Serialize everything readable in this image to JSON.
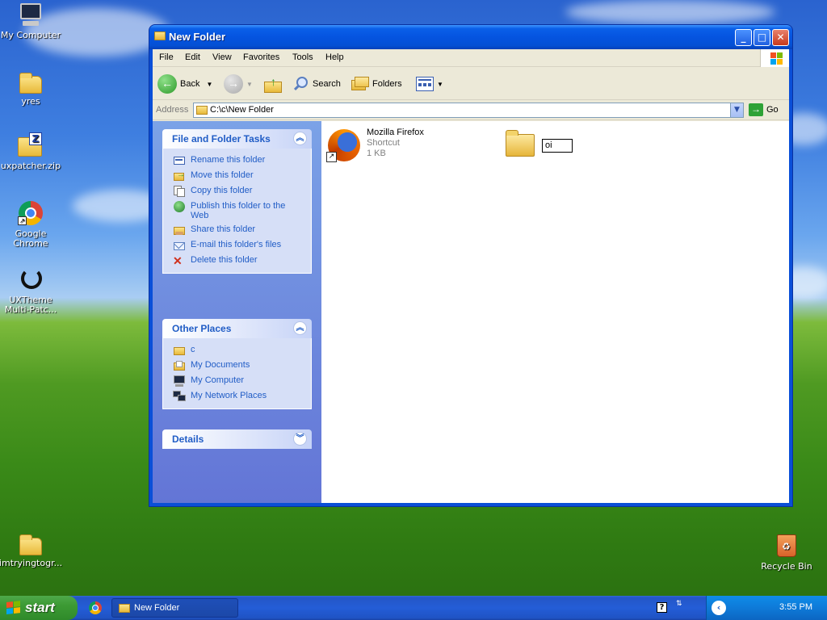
{
  "desktop": {
    "icons": [
      {
        "label": "My Computer"
      },
      {
        "label": "yres"
      },
      {
        "label": "uxpatcher.zip"
      },
      {
        "label": "Google Chrome"
      },
      {
        "label": "UXTheme Multi-Patc..."
      },
      {
        "label": "imtryingtogr..."
      },
      {
        "label": "Recycle Bin"
      }
    ]
  },
  "window": {
    "title": "New Folder",
    "menu": [
      "File",
      "Edit",
      "View",
      "Favorites",
      "Tools",
      "Help"
    ],
    "toolbar": {
      "back": "Back",
      "search": "Search",
      "folders": "Folders"
    },
    "address": {
      "label": "Address",
      "value": "C:\\c\\New Folder",
      "go": "Go"
    },
    "task_pane": {
      "file_tasks": {
        "title": "File and Folder Tasks",
        "items": [
          "Rename this folder",
          "Move this folder",
          "Copy this folder",
          "Publish this folder to the Web",
          "Share this folder",
          "E-mail this folder's files",
          "Delete this folder"
        ]
      },
      "other_places": {
        "title": "Other Places",
        "items": [
          "c",
          "My Documents",
          "My Computer",
          "My Network Places"
        ]
      },
      "details": {
        "title": "Details"
      }
    },
    "files": [
      {
        "name": "Mozilla Firefox",
        "type": "Shortcut",
        "size": "1 KB"
      }
    ],
    "rename_value": "oi"
  },
  "taskbar": {
    "start": "start",
    "task_button": "New Folder",
    "clock": "3:55 PM"
  },
  "colors": {
    "xp_blue": "#0a4fd8",
    "task_link": "#215dc6",
    "start_green": "#3c9a34"
  }
}
